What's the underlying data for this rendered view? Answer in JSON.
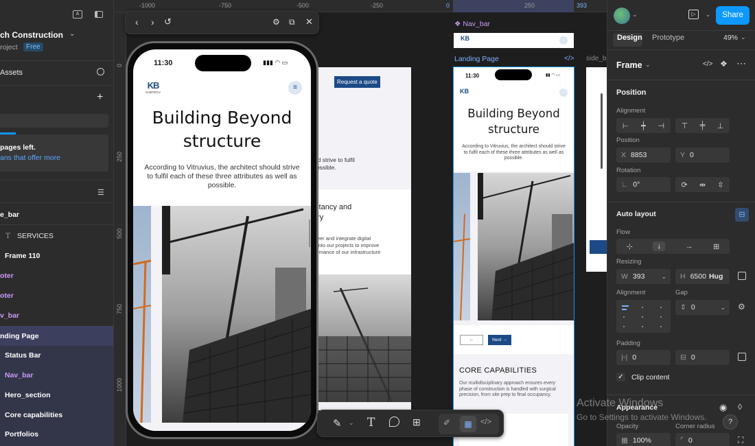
{
  "left_panel": {
    "project_name": "ch Construction",
    "project_sub": "roject",
    "free_badge": "Free",
    "assets_label": "Assets",
    "pages_left": "pages left.",
    "upgrade_link": "ans that offer more",
    "layers": [
      {
        "label": "e_bar",
        "style": "bold"
      },
      {
        "label": "SERVICES",
        "style": "text"
      },
      {
        "label": "Frame 110",
        "style": "bold"
      },
      {
        "label": "oter",
        "style": "purple"
      },
      {
        "label": "oter",
        "style": "purple"
      },
      {
        "label": "v_bar",
        "style": "purple"
      },
      {
        "label": "nding Page",
        "style": "selected"
      },
      {
        "label": "Status Bar",
        "style": "child"
      },
      {
        "label": "Nav_bar",
        "style": "child-purple"
      },
      {
        "label": "Hero_section",
        "style": "child"
      },
      {
        "label": "Core capabilities",
        "style": "child"
      },
      {
        "label": "Portfolios",
        "style": "child"
      }
    ]
  },
  "rulers": {
    "top": [
      "-1000",
      "-750",
      "-500",
      "-250",
      "0",
      "250",
      "393"
    ],
    "left": [
      "0",
      "250",
      "500",
      "750",
      "1000"
    ]
  },
  "canvas": {
    "nav_bar_label": "Nav_bar",
    "landing_page_label": "Landing Page",
    "side_label": "side_b",
    "request_quote": "Request a quote",
    "behind_text_1": "uld strive to fulfil",
    "behind_text_2": "possible.",
    "behind_heading_1": "ultancy and",
    "behind_heading_2": "ory",
    "behind_para": "ineer and integrate digital\ns into our projects to improve\nformance of our infrastructure"
  },
  "phone": {
    "time": "11:30",
    "logo": "KB",
    "logo_sub": "KABTECH",
    "headline_1": "Building Beyond",
    "headline_2": "structure",
    "body": "According to Vitruvius, the architect should strive to fulfil each of these three attributes as well as possible."
  },
  "mini_frame": {
    "time": "11:30",
    "headline_1": "Building Beyond",
    "headline_2": "structure",
    "body": "According to Vitruvius, the architect should strive to fulfil each of these three attributes as well as possible.",
    "prev": "←",
    "next": "Next →",
    "core_title": "CORE CAPABILITIES",
    "core_body": "Our multidisciplinary approach ensures every phase of construction is handled with surgical precision, from site prep to final occupancy."
  },
  "right_panel": {
    "share": "Share",
    "tab_design": "Design",
    "tab_prototype": "Prototype",
    "zoom": "49%",
    "frame_label": "Frame",
    "position_head": "Position",
    "alignment_label": "Alignment",
    "position_label": "Position",
    "x_label": "X",
    "x_value": "8853",
    "y_label": "Y",
    "y_value": "0",
    "rotation_label": "Rotation",
    "rotation_value": "0°",
    "auto_layout_head": "Auto layout",
    "flow_label": "Flow",
    "resizing_label": "Resizing",
    "w_label": "W",
    "w_value": "393",
    "h_label": "H",
    "h_value": "6500",
    "h_mode": "Hug",
    "al_alignment_label": "Alignment",
    "gap_label": "Gap",
    "gap_value": "0",
    "padding_label": "Padding",
    "pad_h": "0",
    "pad_v": "0",
    "clip_content": "Clip content",
    "appearance_head": "Appearance",
    "opacity_label": "Opacity",
    "opacity_value": "100%",
    "corner_label": "Corner radius",
    "corner_value": "0"
  },
  "watermark": {
    "title": "Activate Windows",
    "sub": "Go to Settings to activate Windows."
  },
  "colors": {
    "accent": "#0d99ff",
    "selection": "#3d3f5e",
    "navy": "#1c4a86",
    "component": "#c79cf7"
  }
}
